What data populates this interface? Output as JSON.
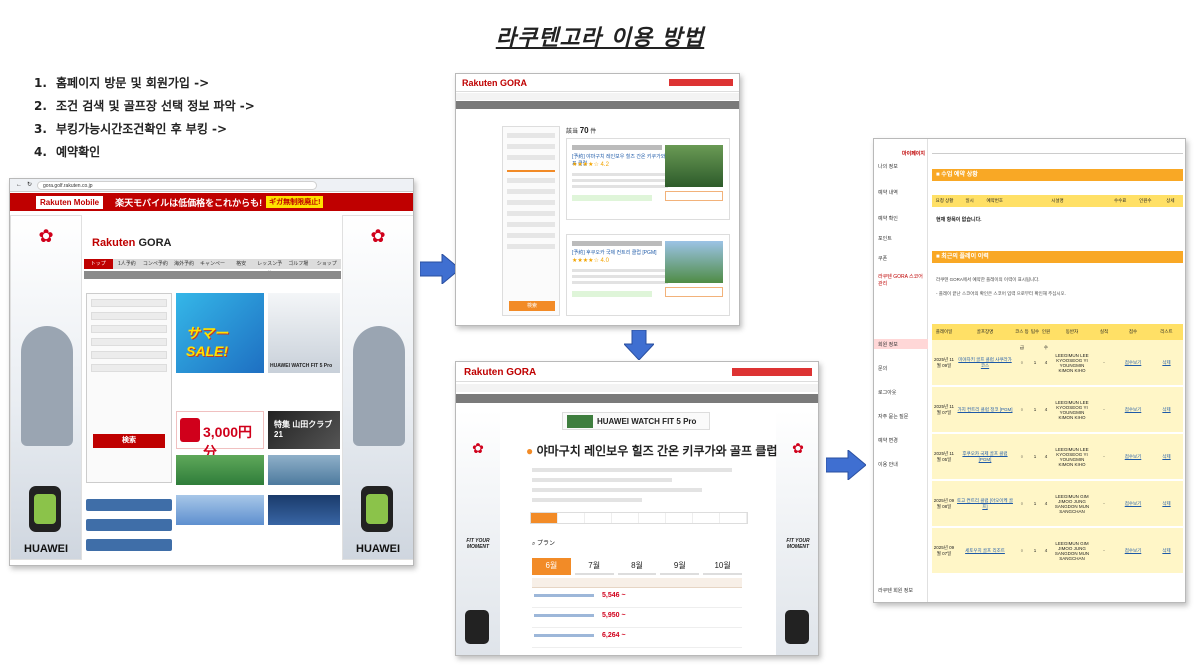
{
  "title": "라쿠텐고라 이용 방법",
  "steps": [
    {
      "num": "1.",
      "text": "홈페이지 방문 및 회원가입 ->"
    },
    {
      "num": "2.",
      "text": "조건 검색 및 골프장 선택 정보 파악 ->"
    },
    {
      "num": "3.",
      "text": "부킹가능시간조건확인 후 부킹 ->"
    },
    {
      "num": "4.",
      "text": "예약확인"
    }
  ],
  "colors": {
    "brand_red": "#bf0000",
    "arrow_blue": "#3f6fd1",
    "accent_orange": "#f28b27",
    "confirm_yellow": "#f9a825"
  },
  "shot1": {
    "url": "gora.golf.rakuten.co.jp",
    "banner_logo": "Rakuten Mobile",
    "banner_msg": "楽天モバイルは低価格をこれからも!",
    "banner_pill": "ギガ無制限廃止!",
    "logo_main": "Rakuten",
    "logo_sub": "GORA",
    "nav": [
      "トップ",
      "1人予約",
      "コンペ予約",
      "海外予約",
      "キャンペーン",
      "格安",
      "レッスン予約",
      "ゴルフ場",
      "ショップ"
    ],
    "search_button": "検索",
    "promo_sale": "サマー SALE!",
    "promo_side": "HUAWEI WATCH FIT 5 Pro",
    "coupon_amount": "3,000円分",
    "banner3": "特集 山田クラブ21",
    "side_brand": "HUAWEI",
    "side_caption": "FIT YOUR MOMENT"
  },
  "shot2": {
    "logo": "Rakuten GORA",
    "count_prefix": "該当",
    "count": "70",
    "count_suffix": "件",
    "card1_name": "[予約] 야마구치 레인보우 힐즈 간온 키쿠가와 골프 클럽",
    "card1_stars": "★★★★☆ 4.2",
    "card2_name": "[予約] 후쿠오카 국제 컨트리 클럽 [PGM]",
    "card2_stars": "★★★★☆ 4.0",
    "search_button": "検索"
  },
  "shot3": {
    "logo": "Rakuten GORA",
    "ad_text": "HUAWEI WATCH FIT 5 Pro",
    "course_name": "야마구치 레인보우 힐즈 간온 키쿠가와 골프 클럽",
    "search_label": "プラン",
    "months": [
      "6월",
      "7월",
      "8월",
      "9월",
      "10월"
    ],
    "prices": [
      "5,546 ~",
      "5,950 ~",
      "6,264 ~"
    ],
    "side_caption": "FIT YOUR MOMENT"
  },
  "shot4": {
    "brand": "마이페이지",
    "menu": [
      "나의 정보",
      "예약 내역",
      "예약 확인",
      "포인트",
      "쿠폰",
      "라쿠텐 GORA 스코어 관리",
      "회원 정보",
      "문의",
      "로그아웃",
      "자주 묻는 질문",
      "예약 변경",
      "이용 안내",
      "라쿠텐 회원 정보"
    ],
    "section1": "수업 예약 상황",
    "section1_headers": [
      "요청 상황",
      "일시",
      "예약번호",
      "",
      "시설명",
      "",
      "수수료",
      "인원수",
      "상세"
    ],
    "empty_msg": "현재 항목이 없습니다.",
    "section2": "최근의 플레이 이력",
    "note1": "라쿠텐 GORA에서 예약한 플레이의 이력이 표시됩니다.",
    "note2": "- 플레이 끝난 스코어의 확인은 스코어 입력 으로부터 확인해 주십시오.",
    "table_headers": [
      "플레이일",
      "골프장명",
      "코스 등급",
      "팀수",
      "인원수",
      "동반자",
      "실적",
      "점수",
      "리스트"
    ],
    "rows": [
      {
        "date": "2025년 11월 09일",
        "course": "미야자키 골프 클럽 사쿠라가 코스",
        "rank": "○",
        "teams": "1",
        "people": "4",
        "partners": "LEEGIMUN LEE KYOOSEOG YI YOUNGMIN KIMON KIHO",
        "result": "-",
        "score": "점수보기",
        "list": "삭제"
      },
      {
        "date": "2025년 11월 07일",
        "course": "가지 컨트리 클럽 정코 [PGM]",
        "rank": "○",
        "teams": "1",
        "people": "4",
        "partners": "LEEGIMUN LEE KYOOSEOG YI YOUNGMIN KIMON KIHO",
        "result": "-",
        "score": "점수보기",
        "list": "삭제"
      },
      {
        "date": "2025년 11월 05일",
        "course": "후쿠오카 국제 골프 클럽 [PGM]",
        "rank": "○",
        "teams": "1",
        "people": "4",
        "partners": "LEEGIMUN LEE KYOOSEOG YI YOUNGMIN KIMON KIHO",
        "result": "-",
        "score": "점수보기",
        "list": "삭제"
      },
      {
        "date": "2025년 09월 08일",
        "course": "토고 컨트리 클럽 [아오이케 골프]",
        "rank": "○",
        "teams": "1",
        "people": "4",
        "partners": "LEEGIMUN GIM JIMOO JUNG SANGDON MUN SANGCHAN",
        "result": "-",
        "score": "점수보기",
        "list": "삭제"
      },
      {
        "date": "2025년 09월 07일",
        "course": "세토우치 골프 리조트",
        "rank": "○",
        "teams": "1",
        "people": "4",
        "partners": "LEEGIMUN GIM JIMOO JUNG SANGDON MUN SANGCHAN",
        "result": "-",
        "score": "점수보기",
        "list": "삭제"
      }
    ]
  }
}
